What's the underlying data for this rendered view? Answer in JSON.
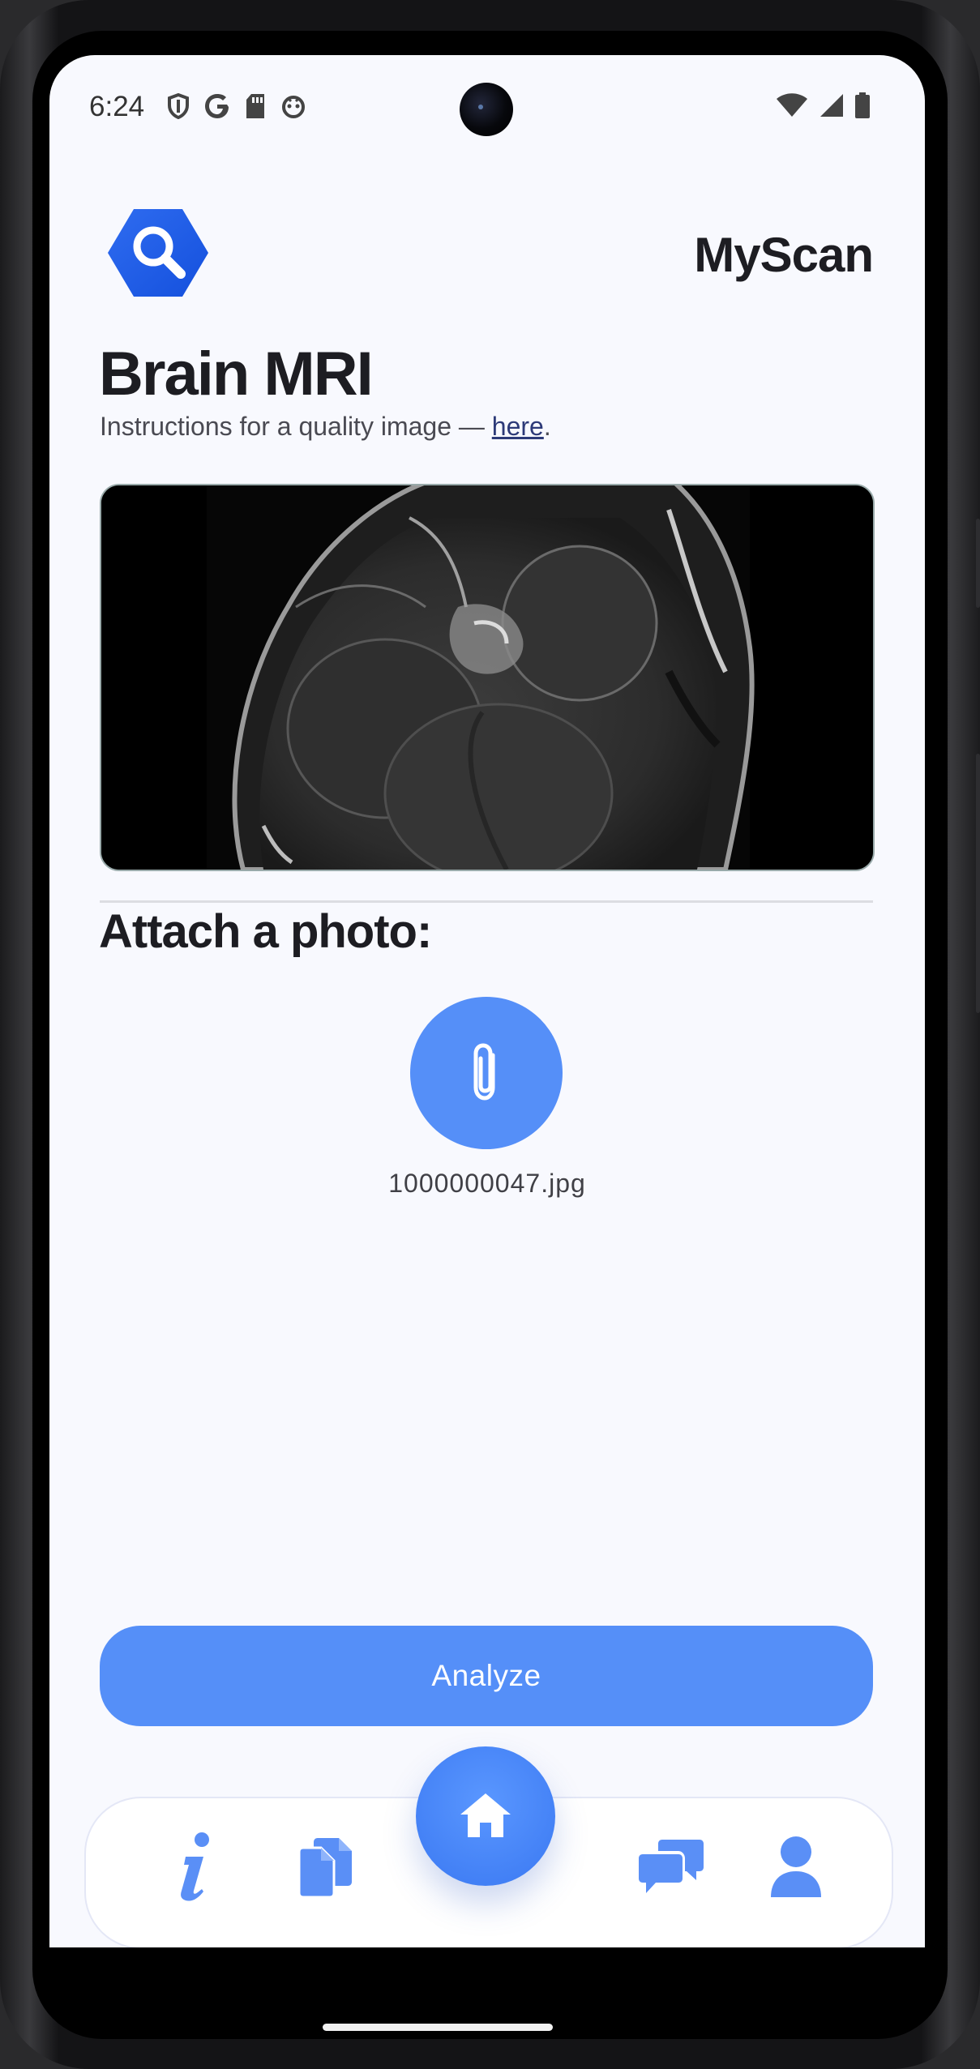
{
  "status_bar": {
    "time": "6:24",
    "icons": [
      "shield-icon",
      "google-icon",
      "sd-card-icon",
      "face-icon",
      "wifi-icon",
      "signal-icon",
      "battery-icon"
    ]
  },
  "header": {
    "app_name": "MyScan",
    "logo_icon": "magnifier-hexagon-icon"
  },
  "page": {
    "title": "Brain MRI",
    "instructions_prefix": "Instructions for a quality image — ",
    "instructions_link": "here",
    "instructions_suffix": "."
  },
  "attach": {
    "heading": "Attach a photo:",
    "button_icon": "paperclip-icon",
    "filename": "1000000047.jpg"
  },
  "analyze_button": {
    "label": "Analyze"
  },
  "nav": {
    "items": [
      {
        "name": "info",
        "icon": "info-icon"
      },
      {
        "name": "documents",
        "icon": "documents-icon"
      },
      {
        "name": "home",
        "icon": "home-icon"
      },
      {
        "name": "chat",
        "icon": "chat-icon"
      },
      {
        "name": "profile",
        "icon": "user-icon"
      }
    ]
  },
  "colors": {
    "accent": "#558ff8",
    "home_button": "#3a78f2",
    "background": "#f8f9fe",
    "link": "#2d3a78",
    "text_dark": "#1d1d22"
  }
}
